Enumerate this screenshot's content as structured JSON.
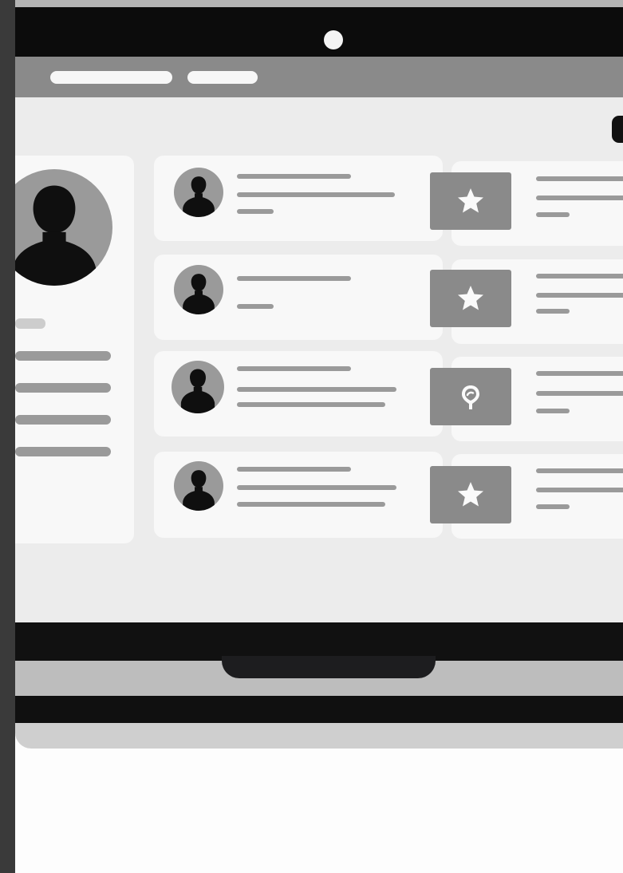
{
  "colors": {
    "bezel": "#0c0c0c",
    "header_bar": "#8a8a8a",
    "screen_bg": "#ececec",
    "card_bg": "#f8f8f8",
    "placeholder_line": "#9a9a9a",
    "avatar": "#9a9a9a",
    "badge": "#8a8a8a"
  },
  "header": {
    "title_placeholder": "",
    "subtitle_placeholder": ""
  },
  "profile": {
    "icon": "person-silhouette-icon"
  },
  "feed": {
    "items": [
      {
        "icon": "person-silhouette-icon",
        "badge_icon": "star-icon"
      },
      {
        "icon": "person-silhouette-icon",
        "badge_icon": "star-icon"
      },
      {
        "icon": "person-silhouette-icon",
        "badge_icon": "map-pin-icon"
      },
      {
        "icon": "person-silhouette-icon",
        "badge_icon": "star-icon"
      }
    ]
  }
}
